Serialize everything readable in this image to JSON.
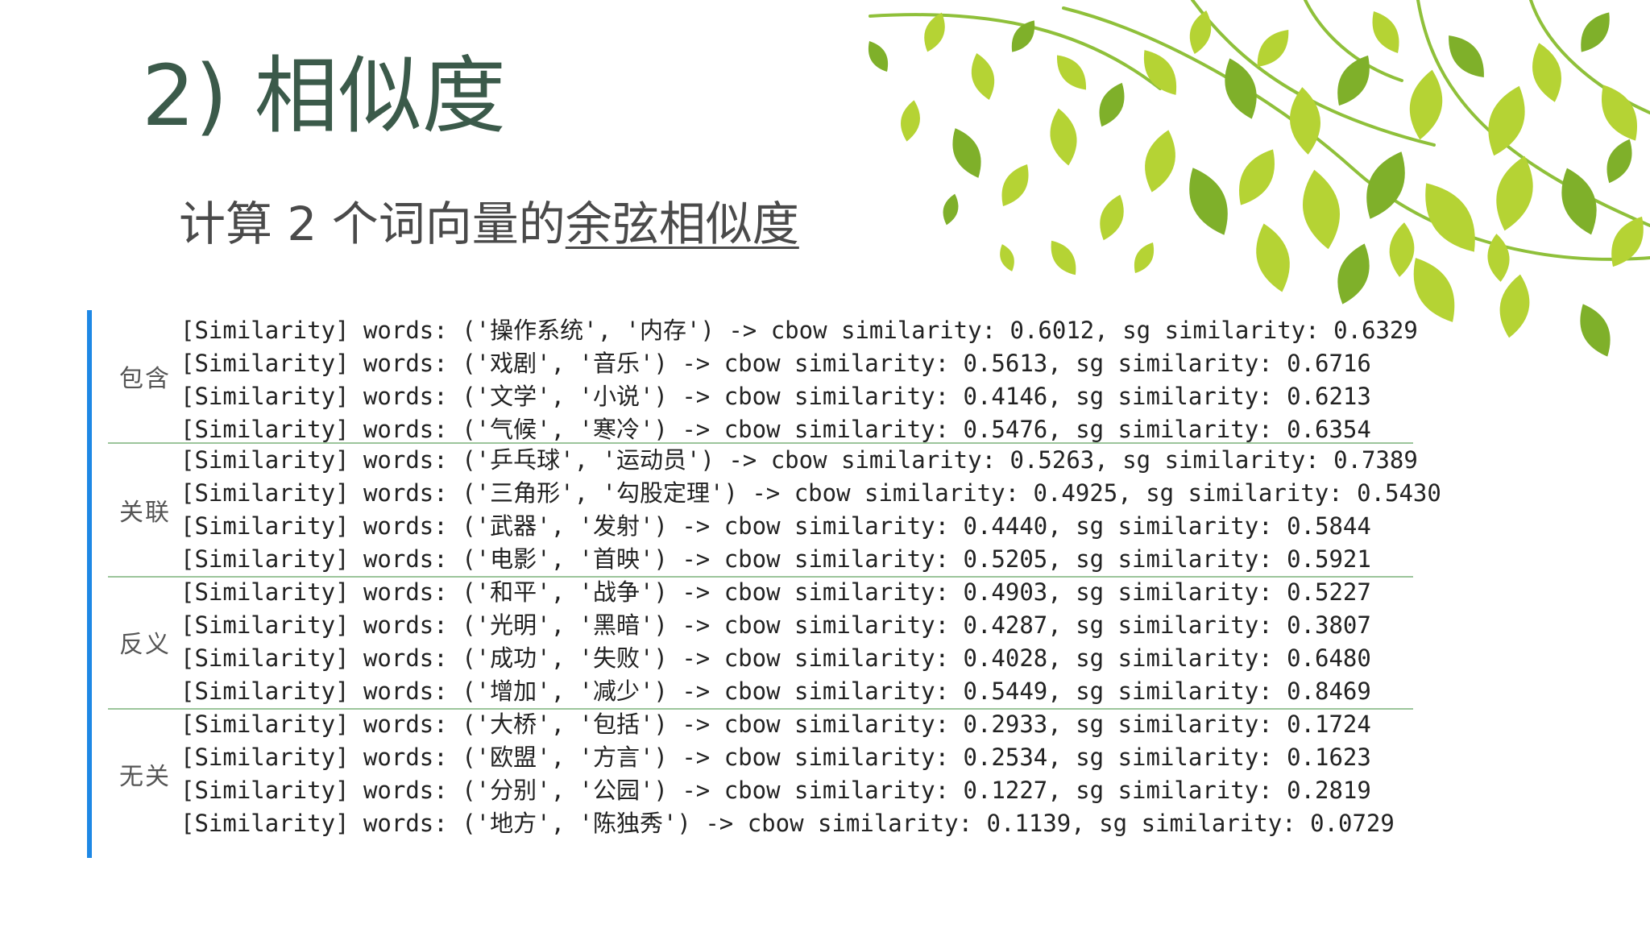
{
  "slide": {
    "title": "2) 相似度",
    "subtitle_prefix": "计算 2 个词向量的",
    "subtitle_link": "余弦相似度"
  },
  "groups": [
    {
      "label": "包含",
      "lines": [
        "[Similarity] words: ('操作系统', '内存') -> cbow similarity: 0.6012, sg similarity: 0.6329",
        "[Similarity] words: ('戏剧', '音乐') -> cbow similarity: 0.5613, sg similarity: 0.6716",
        "[Similarity] words: ('文学', '小说') -> cbow similarity: 0.4146, sg similarity: 0.6213",
        "[Similarity] words: ('气候', '寒冷') -> cbow similarity: 0.5476, sg similarity: 0.6354"
      ]
    },
    {
      "label": "关联",
      "lines": [
        "[Similarity] words: ('乒乓球', '运动员') -> cbow similarity: 0.5263, sg similarity: 0.7389",
        "[Similarity] words: ('三角形', '勾股定理') -> cbow similarity: 0.4925, sg similarity: 0.5430",
        "[Similarity] words: ('武器', '发射') -> cbow similarity: 0.4440, sg similarity: 0.5844",
        "[Similarity] words: ('电影', '首映') -> cbow similarity: 0.5205, sg similarity: 0.5921"
      ]
    },
    {
      "label": "反义",
      "lines": [
        "[Similarity] words: ('和平', '战争') -> cbow similarity: 0.4903, sg similarity: 0.5227",
        "[Similarity] words: ('光明', '黑暗') -> cbow similarity: 0.4287, sg similarity: 0.3807",
        "[Similarity] words: ('成功', '失败') -> cbow similarity: 0.4028, sg similarity: 0.6480",
        "[Similarity] words: ('增加', '减少') -> cbow similarity: 0.5449, sg similarity: 0.8469"
      ]
    },
    {
      "label": "无关",
      "lines": [
        "[Similarity] words: ('大桥', '包括') -> cbow similarity: 0.2933, sg similarity: 0.1724",
        "[Similarity] words: ('欧盟', '方言') -> cbow similarity: 0.2534, sg similarity: 0.1623",
        "[Similarity] words: ('分别', '公园') -> cbow similarity: 0.1227, sg similarity: 0.2819",
        "[Similarity] words: ('地方', '陈独秀') -> cbow similarity: 0.1139, sg similarity: 0.0729"
      ]
    }
  ],
  "colors": {
    "title": "#3b5a4a",
    "accent_bar": "#1e88e5",
    "separator": "#9cc59b",
    "leaf_light": "#b5d334",
    "leaf_dark": "#7fb02a",
    "branch": "#8fc03a"
  }
}
